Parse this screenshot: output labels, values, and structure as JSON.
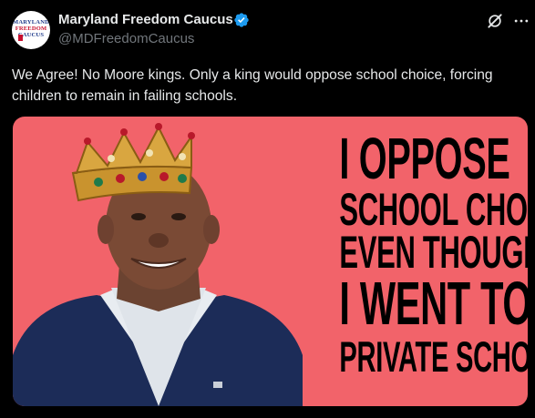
{
  "author": {
    "name": "Maryland Freedom Caucus",
    "handle": "@MDFreedomCaucus",
    "avatar_lines": [
      "MARYLAND",
      "FREEDOM",
      "CAUCUS"
    ]
  },
  "icons": {
    "verified": "verified-badge-icon",
    "grok": "grok-icon",
    "more": "more-options-icon"
  },
  "tweet": {
    "text": "We Agree! No Moore kings. Only a king would oppose school choice, forcing children to remain in failing schools."
  },
  "media": {
    "background_color": "#f2636a",
    "slogan_lines": [
      "I OPPOSE",
      "SCHOOL CHOICE",
      "EVEN THOUGH",
      "I WENT TO",
      "PRIVATE SCHOOL"
    ]
  },
  "colors": {
    "verified_blue": "#1d9bf0",
    "text_primary": "#e7e9ea",
    "text_secondary": "#71767b"
  }
}
